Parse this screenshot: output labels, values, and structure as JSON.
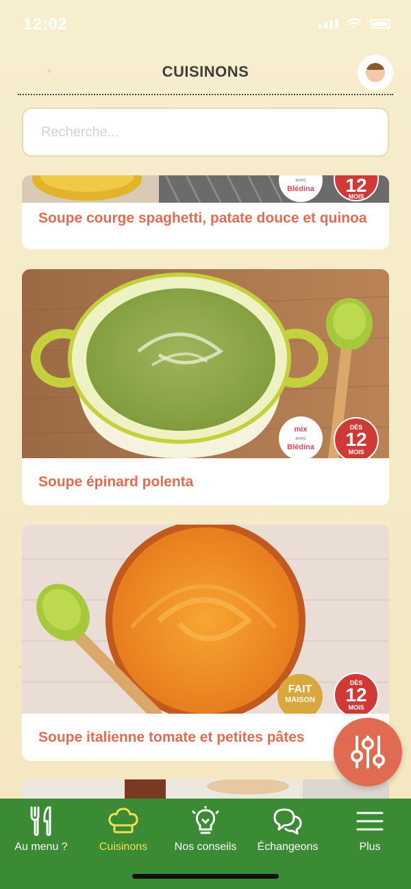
{
  "status_bar": {
    "time": "12:02"
  },
  "header": {
    "title": "CUISINONS"
  },
  "search": {
    "placeholder": "Recherche..."
  },
  "recipes": [
    {
      "title": "Soupe courge spaghetti, patate douce et quinoa",
      "age_number": "12",
      "age_unit": "MOIS",
      "badge": "mix avec Blédina"
    },
    {
      "title": "Soupe épinard polenta",
      "age_prefix": "DÈS",
      "age_number": "12",
      "age_unit": "MOIS",
      "badge": "mix avec Blédina"
    },
    {
      "title": "Soupe italienne tomate et petites pâtes",
      "age_prefix": "DÈS",
      "age_number": "12",
      "age_unit": "MOIS",
      "badge_line1": "FAIT",
      "badge_line2": "MAISON"
    }
  ],
  "mix_badge": {
    "line1": "mix",
    "line2": "avec",
    "line3": "Blédina"
  },
  "bottom_nav": [
    {
      "label": "Au menu ?",
      "icon": "utensils-icon",
      "active": false
    },
    {
      "label": "Cuisinons",
      "icon": "chef-hat-icon",
      "active": true
    },
    {
      "label": "Nos conseils",
      "icon": "lightbulb-icon",
      "active": false
    },
    {
      "label": "Échangeons",
      "icon": "chat-bubbles-icon",
      "active": false
    },
    {
      "label": "Plus",
      "icon": "hamburger-menu-icon",
      "active": false
    }
  ],
  "colors": {
    "accent": "#e06c52",
    "nav_bg": "#3a8b33",
    "nav_active": "#f6df4f",
    "age_badge": "#cf3a37",
    "fait_badge": "#d9a73c"
  }
}
